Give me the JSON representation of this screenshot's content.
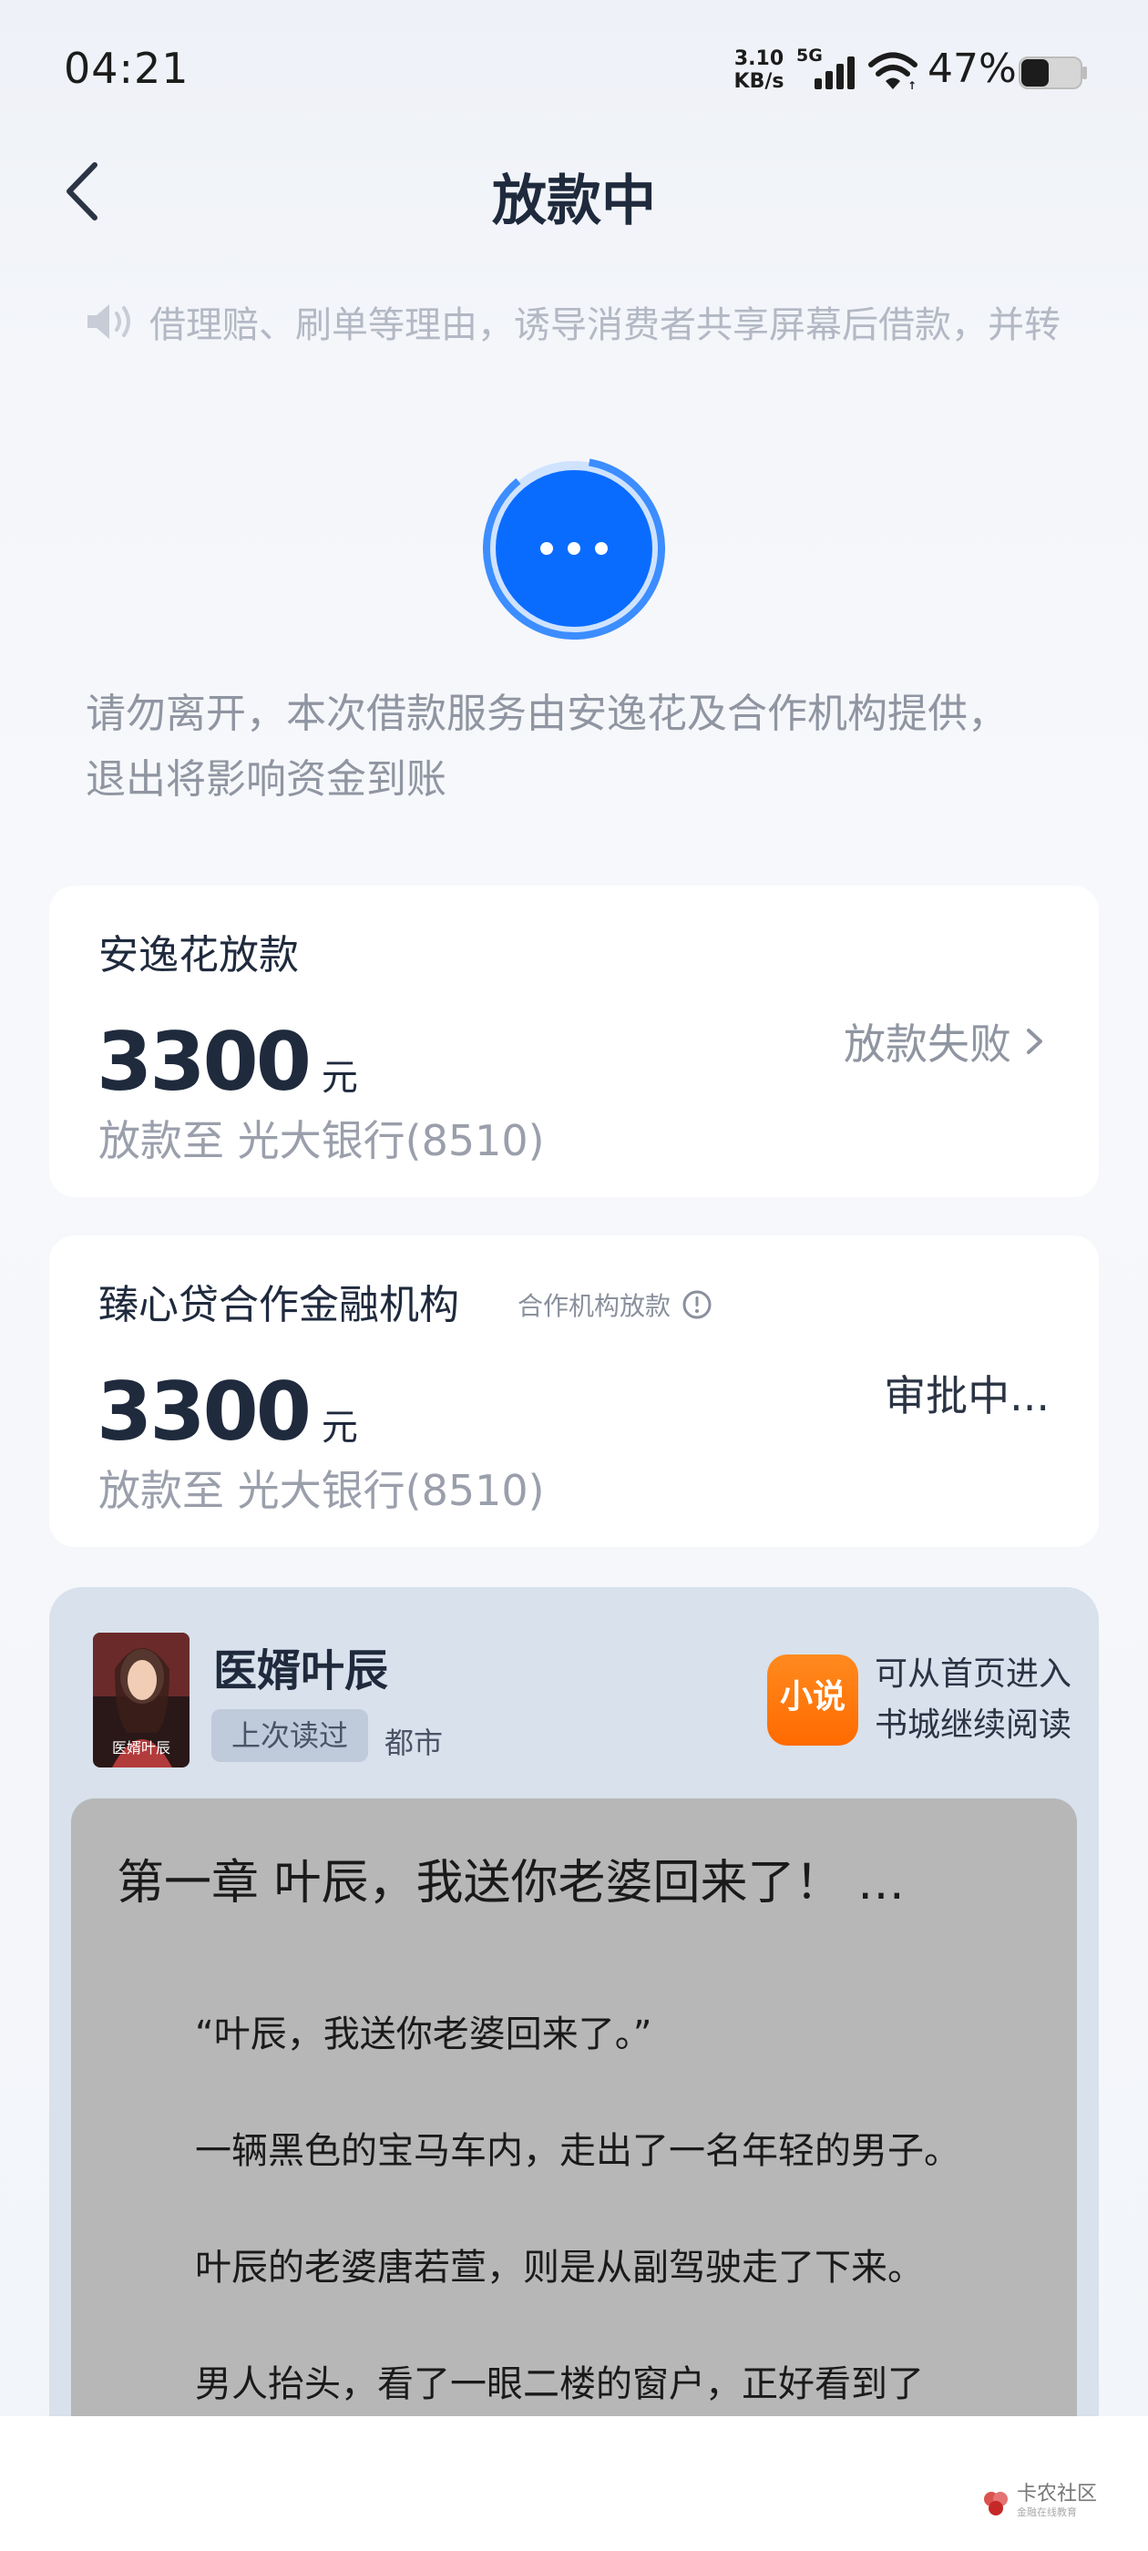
{
  "status_bar": {
    "time": "04:21",
    "speed_value": "3.10",
    "speed_unit": "KB/s",
    "network": "5G",
    "battery_pct": "47%",
    "battery_level": 0.47,
    "icons": [
      "signal-icon",
      "wifi-icon",
      "battery-icon"
    ]
  },
  "nav": {
    "title": "放款中",
    "back_icon": "chevron-left-icon"
  },
  "notice": {
    "icon": "speaker-icon",
    "text": "借理赔、刷单等理由，诱导消费者共享屏幕后借款，并转"
  },
  "loader": {
    "icon": "loading-dots-icon"
  },
  "stay_message": "请勿离开，本次借款服务由安逸花及合作机构提供，退出将影响资金到账",
  "cards": [
    {
      "title": "安逸花放款",
      "amount": "3300",
      "unit": "元",
      "destination": "放款至 光大银行(8510)",
      "status": "放款失败"
    },
    {
      "title": "臻心贷合作金融机构",
      "tag": "合作机构放款",
      "amount": "3300",
      "unit": "元",
      "destination": "放款至 光大银行(8510)",
      "status": "审批中..."
    }
  ],
  "novel": {
    "cover_text": "医婿叶辰",
    "title": "医婿叶辰",
    "badge": "上次读过",
    "genre": "都市",
    "app_icon_label": "小说",
    "app_tip": "可从首页进入书城继续阅读",
    "chapter_title": "第一章 叶辰，我送你老婆回来了！ …",
    "paragraphs": [
      "“叶辰，我送你老婆回来了。”",
      "一辆黑色的宝马车内，走出了一名年轻的男子。",
      "叶辰的老婆唐若萱，则是从副驾驶走了下来。",
      "男人抬头，看了一眼二楼的窗户，正好看到了"
    ]
  },
  "watermark": {
    "name": "卡农社区",
    "sub": "金融在线教育"
  },
  "colors": {
    "accent": "#0a6cff",
    "title": "#1f2a3d",
    "muted": "#8f95a1",
    "novel_bg": "#d8e1ec",
    "reader_bg": "#b7b7b7"
  }
}
